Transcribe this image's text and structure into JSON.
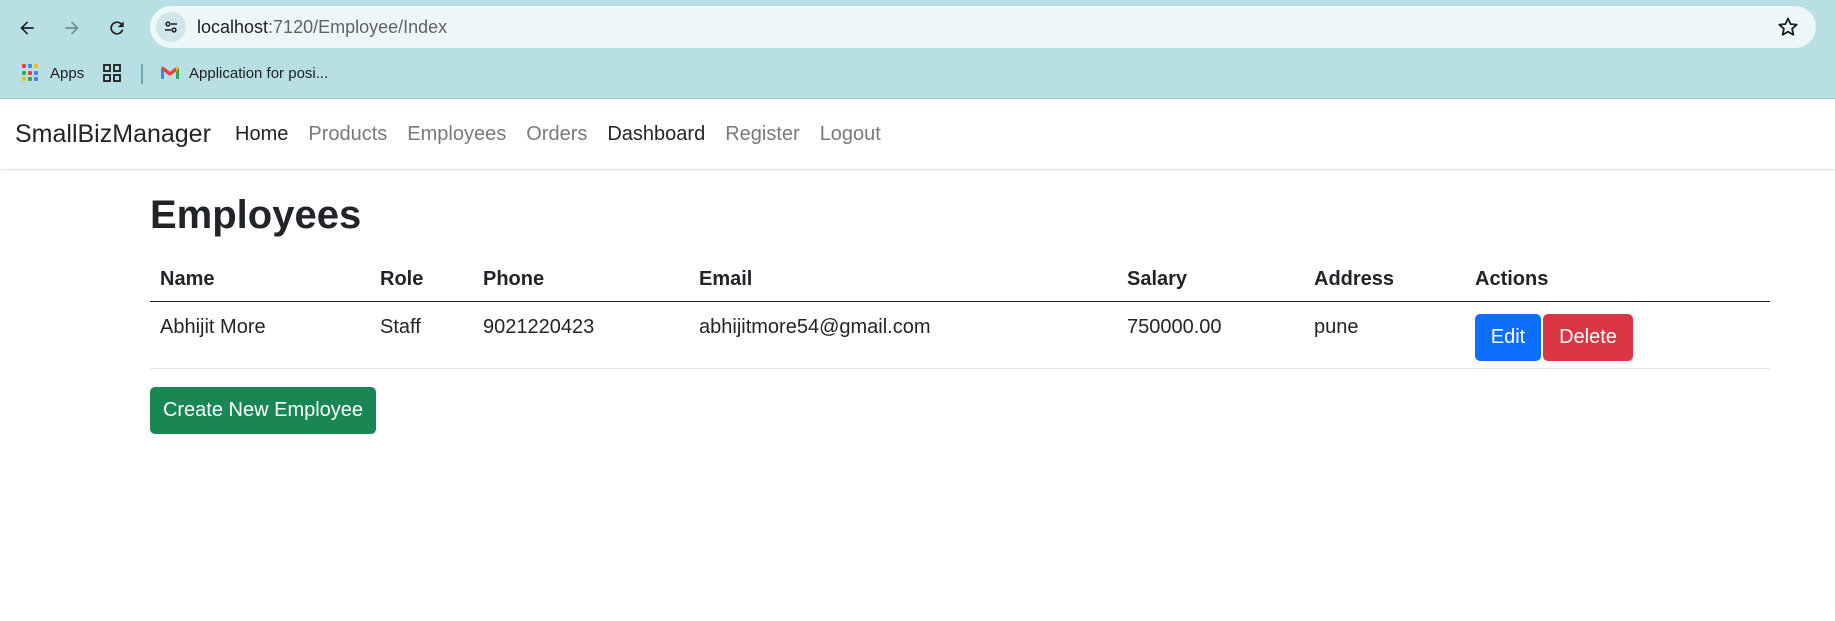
{
  "browser": {
    "url_host": "localhost",
    "url_path": ":7120/Employee/Index",
    "bookmarks": {
      "apps_label": "Apps",
      "gmail_label": "Application for posi..."
    }
  },
  "navbar": {
    "brand": "SmallBizManager",
    "links": [
      "Home",
      "Products",
      "Employees",
      "Orders",
      "Dashboard",
      "Register",
      "Logout"
    ]
  },
  "page": {
    "title": "Employees",
    "columns": [
      "Name",
      "Role",
      "Phone",
      "Email",
      "Salary",
      "Address",
      "Actions"
    ],
    "rows": [
      {
        "name": "Abhijit More",
        "role": "Staff",
        "phone": "9021220423",
        "email": "abhijitmore54@gmail.com",
        "salary": "750000.00",
        "address": "pune",
        "edit_label": "Edit",
        "delete_label": "Delete"
      }
    ],
    "create_label": "Create New Employee"
  },
  "colors": {
    "chrome_bg": "#b8e0e4",
    "edit": "#0d6efd",
    "delete": "#dc3545",
    "create": "#198754"
  }
}
